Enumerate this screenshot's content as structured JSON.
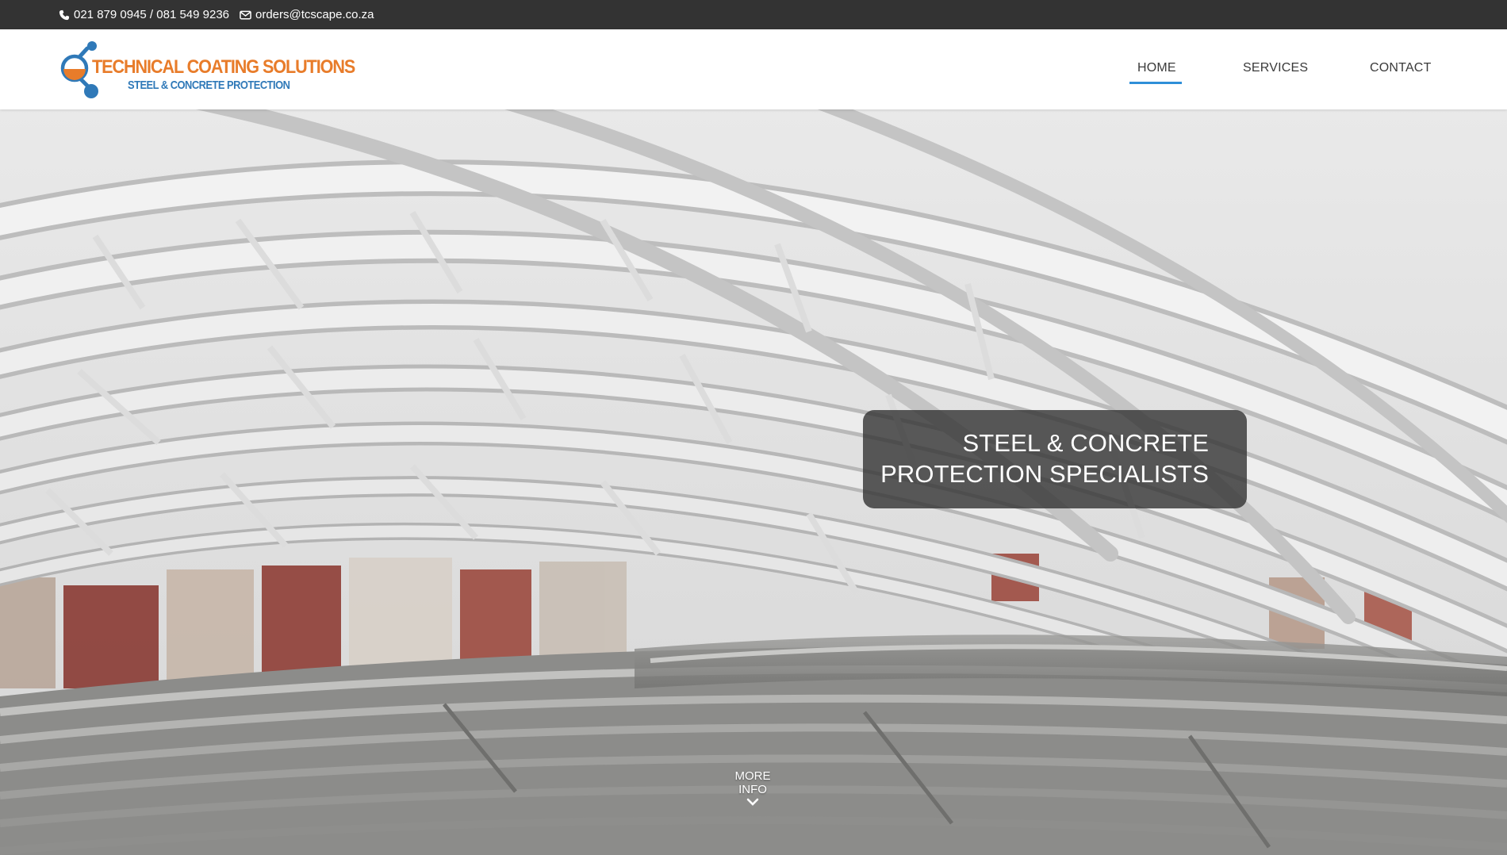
{
  "topbar": {
    "phone": "021 879 0945 / 081 549 9236",
    "email": "orders@tcscape.co.za",
    "icons": [
      "phone-icon",
      "envelope-icon"
    ]
  },
  "header": {
    "logo": {
      "title": "TECHNICAL COATING SOLUTIONS",
      "tagline": "STEEL & CONCRETE PROTECTION"
    },
    "nav": {
      "items": [
        {
          "label": "HOME",
          "active": true
        },
        {
          "label": "SERVICES",
          "active": false
        },
        {
          "label": "CONTACT",
          "active": false
        }
      ],
      "active_color": "#2f8fd8"
    }
  },
  "hero": {
    "headline_line1": "STEEL & CONCRETE",
    "headline_line2": "PROTECTION SPECIALISTS",
    "more_info_label": "MORE INFO",
    "more_info_icon": "chevron-down-icon"
  },
  "colors": {
    "topbar_bg": "#333333",
    "brand_orange": "#e87c2a",
    "brand_blue": "#2f79b8"
  }
}
